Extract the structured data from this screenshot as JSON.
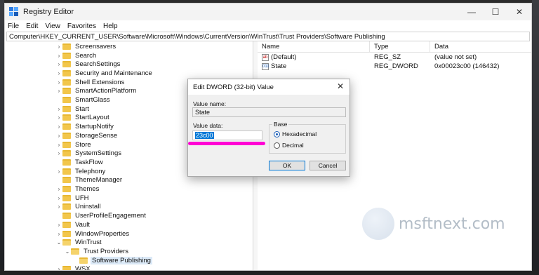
{
  "window": {
    "title": "Registry Editor",
    "controls": {
      "minimize": "—",
      "maximize": "☐",
      "close": "✕"
    }
  },
  "menu": [
    "File",
    "Edit",
    "View",
    "Favorites",
    "Help"
  ],
  "address": "Computer\\HKEY_CURRENT_USER\\Software\\Microsoft\\Windows\\CurrentVersion\\WinTrust\\Trust Providers\\Software Publishing",
  "tree": [
    {
      "label": "Screensavers",
      "arrow": "›",
      "level": 0
    },
    {
      "label": "Search",
      "arrow": "›",
      "level": 0
    },
    {
      "label": "SearchSettings",
      "arrow": "›",
      "level": 0
    },
    {
      "label": "Security and Maintenance",
      "arrow": "›",
      "level": 0
    },
    {
      "label": "Shell Extensions",
      "arrow": "›",
      "level": 0
    },
    {
      "label": "SmartActionPlatform",
      "arrow": "›",
      "level": 0
    },
    {
      "label": "SmartGlass",
      "arrow": "",
      "level": 0
    },
    {
      "label": "Start",
      "arrow": "›",
      "level": 0
    },
    {
      "label": "StartLayout",
      "arrow": "›",
      "level": 0
    },
    {
      "label": "StartupNotify",
      "arrow": "›",
      "level": 0
    },
    {
      "label": "StorageSense",
      "arrow": "›",
      "level": 0
    },
    {
      "label": "Store",
      "arrow": "›",
      "level": 0
    },
    {
      "label": "SystemSettings",
      "arrow": "›",
      "level": 0
    },
    {
      "label": "TaskFlow",
      "arrow": "",
      "level": 0
    },
    {
      "label": "Telephony",
      "arrow": "›",
      "level": 0
    },
    {
      "label": "ThemeManager",
      "arrow": "",
      "level": 0
    },
    {
      "label": "Themes",
      "arrow": "›",
      "level": 0
    },
    {
      "label": "UFH",
      "arrow": "›",
      "level": 0
    },
    {
      "label": "Uninstall",
      "arrow": "›",
      "level": 0
    },
    {
      "label": "UserProfileEngagement",
      "arrow": "",
      "level": 0
    },
    {
      "label": "Vault",
      "arrow": "›",
      "level": 0
    },
    {
      "label": "WindowProperties",
      "arrow": "›",
      "level": 0
    },
    {
      "label": "WinTrust",
      "arrow": "⌄",
      "level": 0
    },
    {
      "label": "Trust Providers",
      "arrow": "⌄",
      "level": 1
    },
    {
      "label": "Software Publishing",
      "arrow": "",
      "level": 2,
      "selected": true
    },
    {
      "label": "WSX",
      "arrow": "›",
      "level": 0
    }
  ],
  "values": {
    "headers": {
      "name": "Name",
      "type": "Type",
      "data": "Data"
    },
    "rows": [
      {
        "icon": "ab",
        "name": "(Default)",
        "type": "REG_SZ",
        "data": "(value not set)"
      },
      {
        "icon": "011",
        "name": "State",
        "type": "REG_DWORD",
        "data": "0x00023c00 (146432)"
      }
    ]
  },
  "dialog": {
    "title": "Edit DWORD (32-bit) Value",
    "close": "✕",
    "value_name_label": "Value name:",
    "value_name": "State",
    "value_data_label": "Value data:",
    "value_data": "23c00",
    "base_label": "Base",
    "hex_label": "Hexadecimal",
    "dec_label": "Decimal",
    "base_selected": "Hexadecimal",
    "ok": "OK",
    "cancel": "Cancel"
  },
  "watermark": "msftnext.com",
  "colors": {
    "annotation": "#ff00d4",
    "selection": "#0078d7",
    "folder": "#f2c64b"
  }
}
